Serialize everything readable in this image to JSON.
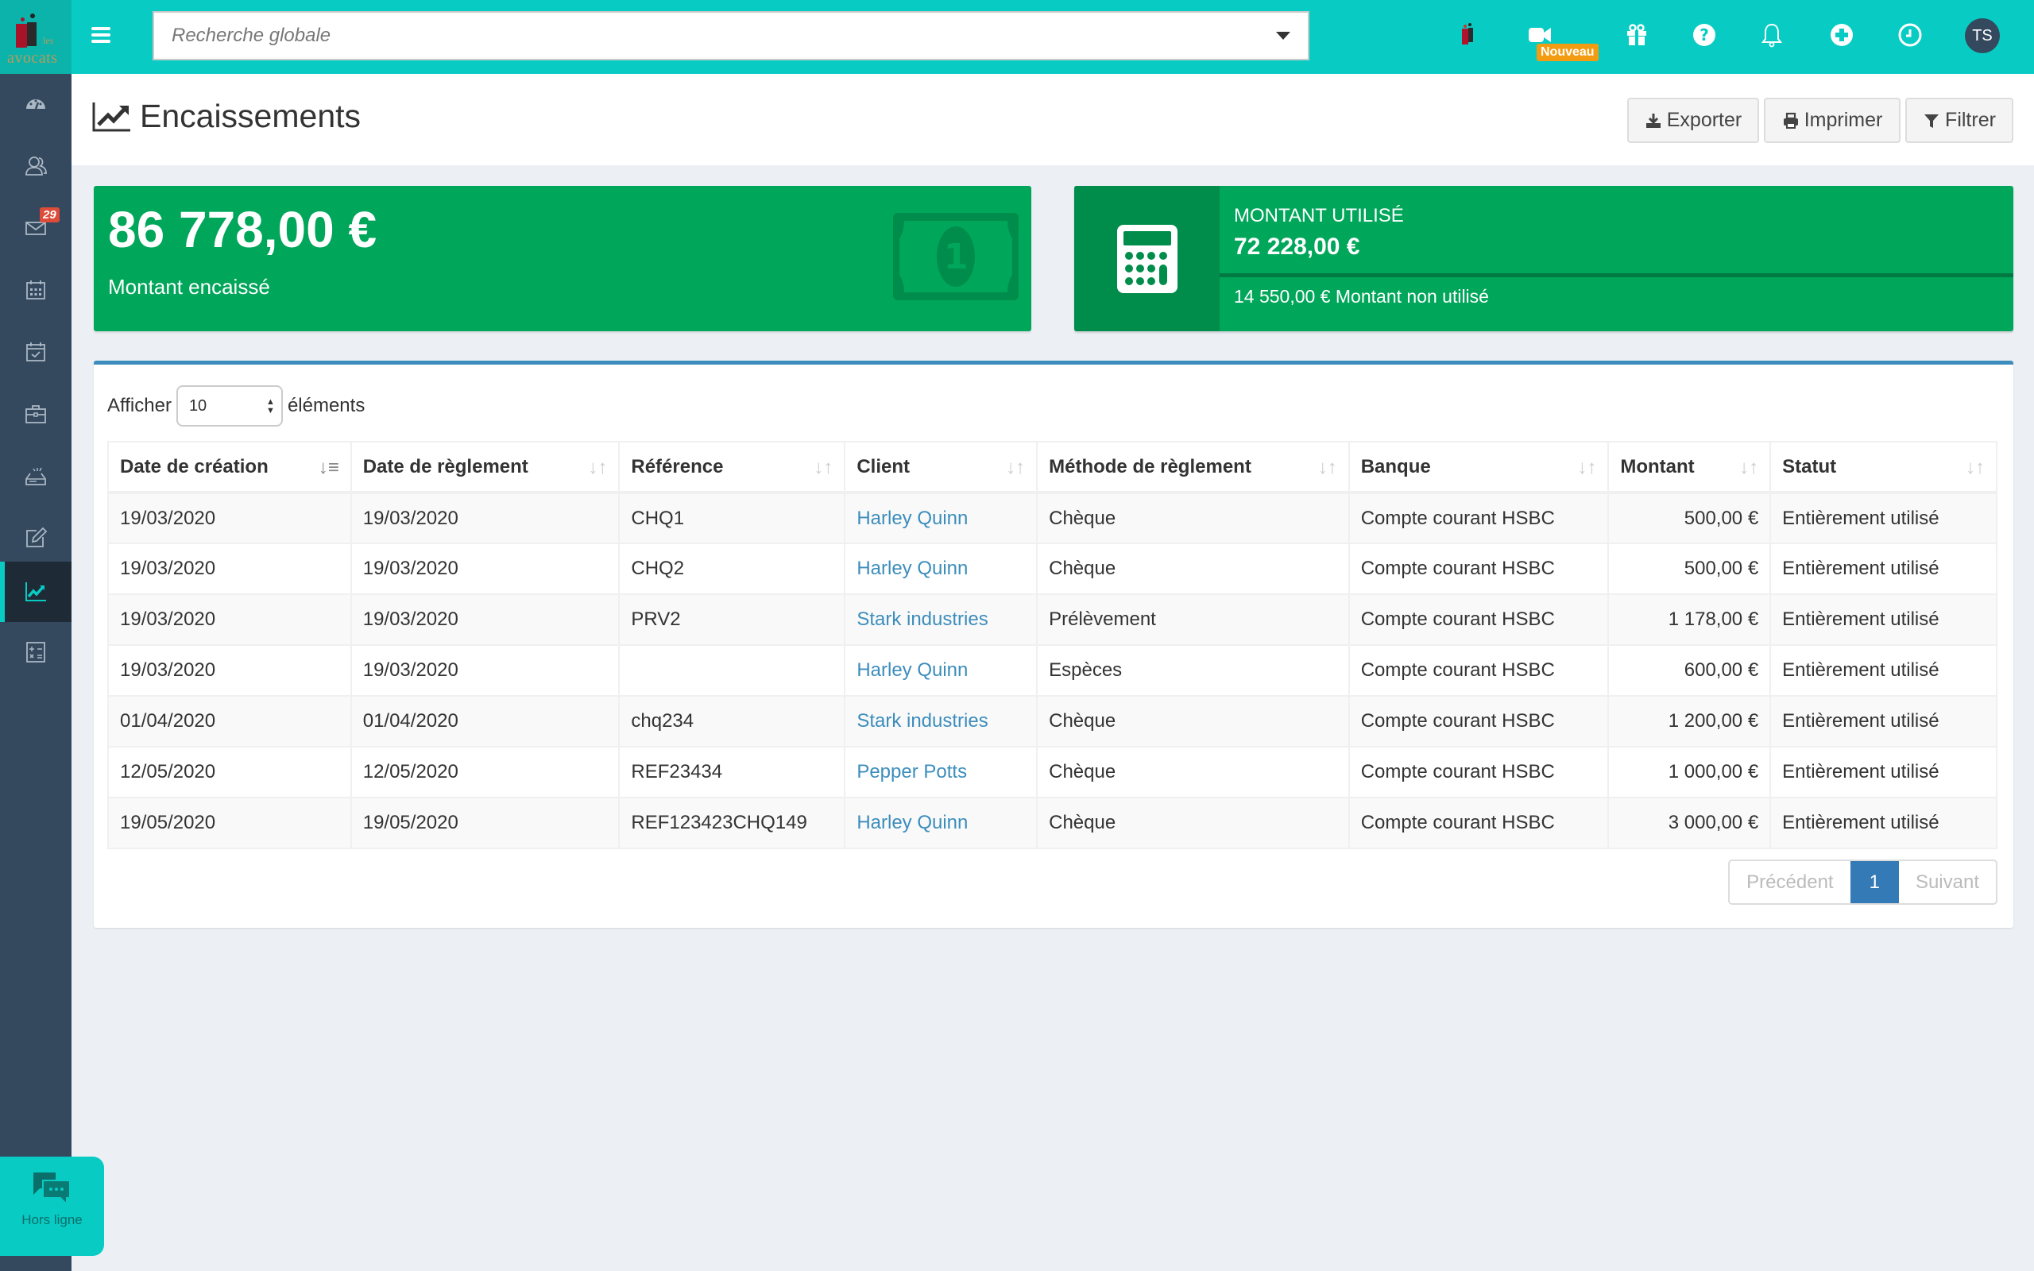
{
  "topbar": {
    "logo_text": "avocats",
    "logo_small": "les",
    "search_placeholder": "Recherche globale",
    "new_badge": "Nouveau",
    "user_initials": "TS",
    "icons": [
      "avocats-icon",
      "video-camera-icon",
      "gift-icon",
      "help-icon",
      "bell-icon",
      "plus-circle-icon",
      "clock-icon"
    ]
  },
  "sidebar": {
    "items": [
      {
        "name": "dashboard",
        "icon": "dashboard-icon"
      },
      {
        "name": "contacts",
        "icon": "users-icon"
      },
      {
        "name": "messages",
        "icon": "envelope-icon",
        "badge": "29"
      },
      {
        "name": "calendar",
        "icon": "calendar-icon"
      },
      {
        "name": "tasks",
        "icon": "calendar-check-icon"
      },
      {
        "name": "cases",
        "icon": "briefcase-icon"
      },
      {
        "name": "inbox",
        "icon": "inbox-icon"
      },
      {
        "name": "edit",
        "icon": "edit-icon"
      },
      {
        "name": "encaissements",
        "icon": "chart-line-icon",
        "active": true
      },
      {
        "name": "calculator",
        "icon": "calculator-icon"
      }
    ]
  },
  "header": {
    "title": "Encaissements",
    "buttons": {
      "export": "Exporter",
      "print": "Imprimer",
      "filter": "Filtrer"
    }
  },
  "stats": {
    "collected": {
      "amount": "86 778,00 €",
      "label": "Montant encaissé"
    },
    "used": {
      "title": "Montant utilisé",
      "amount": "72 228,00 €",
      "progress_percent": 100,
      "description": "14 550,00 € Montant non utilisé"
    }
  },
  "table": {
    "length_label_before": "Afficher",
    "length_value": "10",
    "length_label_after": "éléments",
    "columns": [
      "Date de création",
      "Date de règlement",
      "Référence",
      "Client",
      "Méthode de règlement",
      "Banque",
      "Montant",
      "Statut"
    ],
    "rows": [
      {
        "created": "19/03/2020",
        "paid": "19/03/2020",
        "ref": "CHQ1",
        "client": "Harley Quinn",
        "method": "Chèque",
        "bank": "Compte courant HSBC",
        "amount": "500,00 €",
        "status": "Entièrement utilisé"
      },
      {
        "created": "19/03/2020",
        "paid": "19/03/2020",
        "ref": "CHQ2",
        "client": "Harley Quinn",
        "method": "Chèque",
        "bank": "Compte courant HSBC",
        "amount": "500,00 €",
        "status": "Entièrement utilisé"
      },
      {
        "created": "19/03/2020",
        "paid": "19/03/2020",
        "ref": "PRV2",
        "client": "Stark industries",
        "method": "Prélèvement",
        "bank": "Compte courant HSBC",
        "amount": "1 178,00 €",
        "status": "Entièrement utilisé"
      },
      {
        "created": "19/03/2020",
        "paid": "19/03/2020",
        "ref": "",
        "client": "Harley Quinn",
        "method": "Espèces",
        "bank": "Compte courant HSBC",
        "amount": "600,00 €",
        "status": "Entièrement utilisé"
      },
      {
        "created": "01/04/2020",
        "paid": "01/04/2020",
        "ref": "chq234",
        "client": "Stark industries",
        "method": "Chèque",
        "bank": "Compte courant HSBC",
        "amount": "1 200,00 €",
        "status": "Entièrement utilisé"
      },
      {
        "created": "12/05/2020",
        "paid": "12/05/2020",
        "ref": "REF23434",
        "client": "Pepper Potts",
        "method": "Chèque",
        "bank": "Compte courant HSBC",
        "amount": "1 000,00 €",
        "status": "Entièrement utilisé"
      },
      {
        "created": "19/05/2020",
        "paid": "19/05/2020",
        "ref": "REF123423CHQ149",
        "client": "Harley Quinn",
        "method": "Chèque",
        "bank": "Compte courant HSBC",
        "amount": "3 000,00 €",
        "status": "Entièrement utilisé"
      }
    ],
    "pagination": {
      "previous": "Précédent",
      "current": "1",
      "next": "Suivant"
    }
  },
  "chat": {
    "status": "Hors ligne"
  },
  "colors": {
    "topbar": "#08ccc4",
    "sidebar": "#34495e",
    "success": "#00a65a",
    "success_dark": "#008d4c",
    "primary": "#3c8dbc",
    "badge_new": "#f39c12",
    "badge_count": "#dd4b39"
  }
}
